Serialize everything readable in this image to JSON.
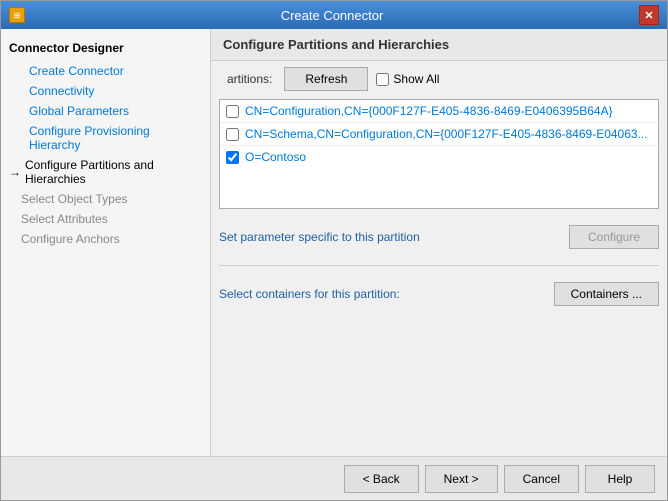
{
  "window": {
    "title": "Create Connector",
    "icon": "⊞",
    "close": "✕"
  },
  "sidebar": {
    "header": "Connector Designer",
    "items": [
      {
        "id": "create-connector",
        "label": "Create Connector",
        "style": "normal"
      },
      {
        "id": "connectivity",
        "label": "Connectivity",
        "style": "normal"
      },
      {
        "id": "global-parameters",
        "label": "Global Parameters",
        "style": "normal"
      },
      {
        "id": "configure-provisioning-hierarchy",
        "label": "Configure Provisioning Hierarchy",
        "style": "normal"
      },
      {
        "id": "configure-partitions",
        "label": "Configure Partitions and Hierarchies",
        "style": "active-arrow"
      },
      {
        "id": "select-object-types",
        "label": "Select Object Types",
        "style": "disabled"
      },
      {
        "id": "select-attributes",
        "label": "Select Attributes",
        "style": "disabled"
      },
      {
        "id": "configure-anchors",
        "label": "Configure Anchors",
        "style": "disabled"
      }
    ]
  },
  "main": {
    "header": "Configure Partitions and Hierarchies",
    "tab_label": "artitions:",
    "refresh_label": "Refresh",
    "show_all_label": "Show All",
    "partitions": [
      {
        "id": "p1",
        "label": "CN=Configuration,CN={000F127F-E405-4836-8469-E0406395B64A}",
        "checked": false
      },
      {
        "id": "p2",
        "label": "CN=Schema,CN=Configuration,CN={000F127F-E405-4836-8469-E04063...",
        "checked": false
      },
      {
        "id": "p3",
        "label": "O=Contoso",
        "checked": true
      }
    ],
    "param_label": "Set parameter specific to this partition",
    "configure_button": "Configure",
    "containers_label": "Select containers for this partition:",
    "containers_button": "Containers ..."
  },
  "footer": {
    "back_label": "< Back",
    "next_label": "Next >",
    "cancel_label": "Cancel",
    "help_label": "Help"
  }
}
